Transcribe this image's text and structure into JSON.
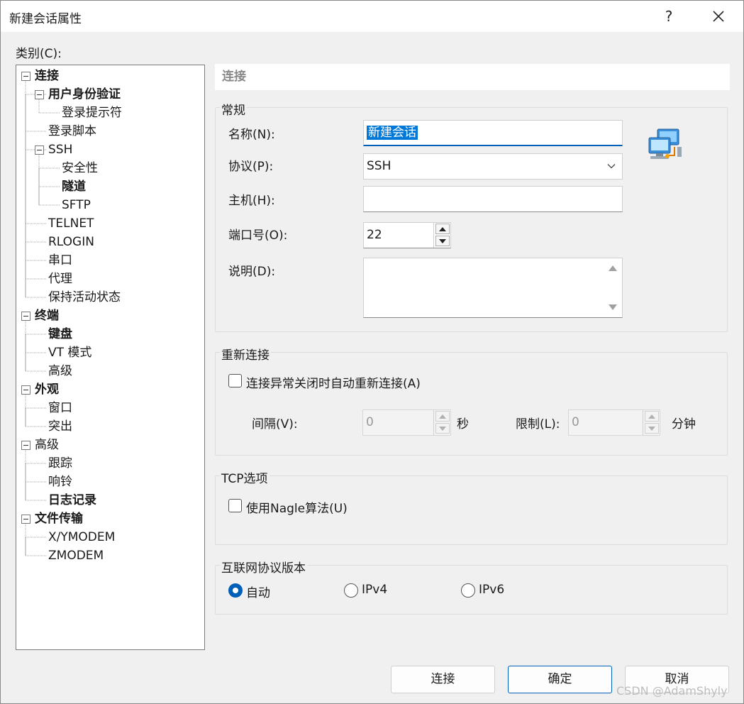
{
  "window": {
    "title": "新建会话属性",
    "help_label": "?",
    "close_icon": "close-icon"
  },
  "category_label": "类别(C):",
  "tree": [
    {
      "label": "连接",
      "level": 0,
      "bold": true,
      "expanded": true,
      "selected": true
    },
    {
      "label": "用户身份验证",
      "level": 1,
      "bold": true,
      "expanded": true
    },
    {
      "label": "登录提示符",
      "level": 2,
      "bold": false
    },
    {
      "label": "登录脚本",
      "level": 1,
      "bold": false
    },
    {
      "label": "SSH",
      "level": 1,
      "bold": false,
      "expanded": true
    },
    {
      "label": "安全性",
      "level": 2,
      "bold": false
    },
    {
      "label": "隧道",
      "level": 2,
      "bold": true
    },
    {
      "label": "SFTP",
      "level": 2,
      "bold": false
    },
    {
      "label": "TELNET",
      "level": 1,
      "bold": false
    },
    {
      "label": "RLOGIN",
      "level": 1,
      "bold": false
    },
    {
      "label": "串口",
      "level": 1,
      "bold": false
    },
    {
      "label": "代理",
      "level": 1,
      "bold": false
    },
    {
      "label": "保持活动状态",
      "level": 1,
      "bold": false
    },
    {
      "label": "终端",
      "level": 0,
      "bold": true,
      "expanded": true
    },
    {
      "label": "键盘",
      "level": 1,
      "bold": true
    },
    {
      "label": "VT 模式",
      "level": 1,
      "bold": false
    },
    {
      "label": "高级",
      "level": 1,
      "bold": false
    },
    {
      "label": "外观",
      "level": 0,
      "bold": true,
      "expanded": true
    },
    {
      "label": "窗口",
      "level": 1,
      "bold": false
    },
    {
      "label": "突出",
      "level": 1,
      "bold": false
    },
    {
      "label": "高级",
      "level": 0,
      "bold": false,
      "expanded": true
    },
    {
      "label": "跟踪",
      "level": 1,
      "bold": false
    },
    {
      "label": "响铃",
      "level": 1,
      "bold": false
    },
    {
      "label": "日志记录",
      "level": 1,
      "bold": true
    },
    {
      "label": "文件传输",
      "level": 0,
      "bold": true,
      "expanded": true
    },
    {
      "label": "X/YMODEM",
      "level": 1,
      "bold": false
    },
    {
      "label": "ZMODEM",
      "level": 1,
      "bold": false
    }
  ],
  "section_title": "连接",
  "general": {
    "title": "常规",
    "name_label": "名称(N):",
    "name_value": "新建会话",
    "protocol_label": "协议(P):",
    "protocol_value": "SSH",
    "host_label": "主机(H):",
    "host_value": "",
    "port_label": "端口号(O):",
    "port_value": "22",
    "desc_label": "说明(D):",
    "desc_value": "",
    "icon": "network-computers-icon"
  },
  "reconnect": {
    "title": "重新连接",
    "checkbox_label": "连接异常关闭时自动重新连接(A)",
    "checked": false,
    "interval_label": "间隔(V):",
    "interval_value": "0",
    "interval_unit": "秒",
    "limit_label": "限制(L):",
    "limit_value": "0",
    "limit_unit": "分钟"
  },
  "tcp": {
    "title": "TCP选项",
    "nagle_label": "使用Nagle算法(U)",
    "checked": false
  },
  "ip_version": {
    "title": "互联网协议版本",
    "options": [
      "自动",
      "IPv4",
      "IPv6"
    ],
    "selected": "自动"
  },
  "buttons": {
    "connect": "连接",
    "ok": "确定",
    "cancel": "取消"
  },
  "watermark": "CSDN @AdamShyly",
  "colors": {
    "accent": "#005fb8",
    "selection": "#0078d7",
    "background": "#f0f0f0"
  }
}
